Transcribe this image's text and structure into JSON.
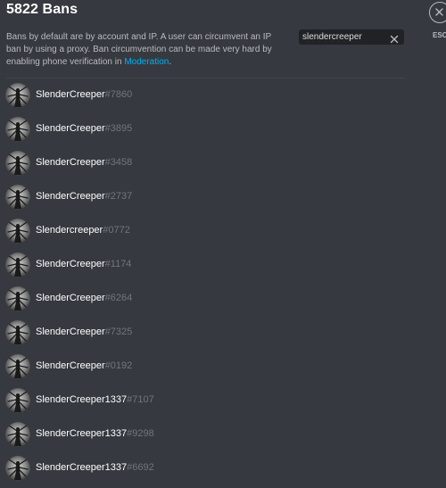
{
  "header": {
    "title": "5822 Bans",
    "description": "Bans by default are by account and IP. A user can circumvent an IP ban by using a proxy. Ban circumvention can be made very hard by enabling phone verification in ",
    "moderation_link": "Moderation",
    "description_end": "."
  },
  "search": {
    "value": "slendercreeper",
    "clear_icon": "close-x-icon"
  },
  "close": {
    "icon": "close-circle-icon",
    "label": "ESC"
  },
  "colors": {
    "background": "#36393f",
    "link": "#00b0f4",
    "discriminator": "#72767d",
    "name": "#ffffff"
  },
  "bans": [
    {
      "name": "SlenderCreeper",
      "tag": "#7860"
    },
    {
      "name": "SlenderCreeper",
      "tag": "#3895"
    },
    {
      "name": "SlenderCreeper",
      "tag": "#3458"
    },
    {
      "name": "SlenderCreeper",
      "tag": "#2737"
    },
    {
      "name": "Slendercreeper",
      "tag": "#0772"
    },
    {
      "name": "SlenderCreeper",
      "tag": "#1174"
    },
    {
      "name": "SlenderCreeper",
      "tag": "#6264"
    },
    {
      "name": "SlenderCreeper",
      "tag": "#7325"
    },
    {
      "name": "SlenderCreeper",
      "tag": "#0192"
    },
    {
      "name": "SlenderCreeper1337",
      "tag": "#7107"
    },
    {
      "name": "SlenderCreeper1337",
      "tag": "#9298"
    },
    {
      "name": "SlenderCreeper1337",
      "tag": "#6692"
    }
  ]
}
